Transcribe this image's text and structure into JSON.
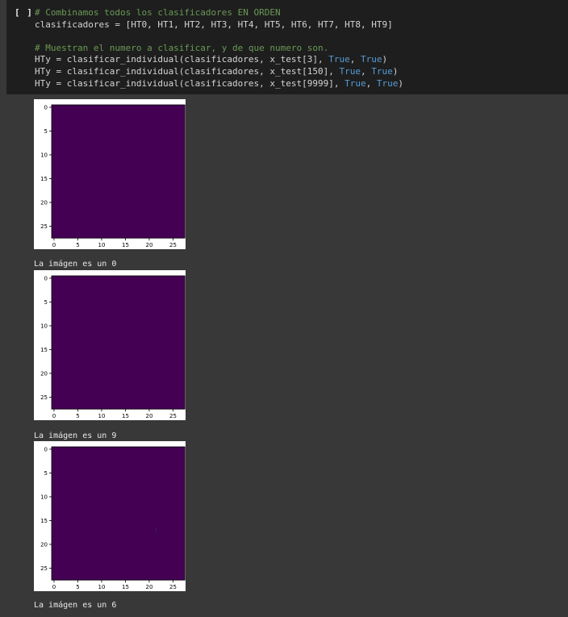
{
  "cell": {
    "run_label": "[ ]",
    "code_lines": [
      {
        "parts": [
          {
            "t": "# Combinamos todos los clasificadores EN ORDEN",
            "c": "cmt"
          }
        ]
      },
      {
        "parts": [
          {
            "t": "clasificadores = [HT0, HT1, HT2, HT3, HT4, HT5, HT6, HT7, HT8, HT9]",
            "c": ""
          }
        ]
      },
      {
        "parts": [
          {
            "t": "",
            "c": ""
          }
        ]
      },
      {
        "parts": [
          {
            "t": "# Muestran el numero a clasificar, y de que numero son.",
            "c": "cmt"
          }
        ]
      },
      {
        "parts": [
          {
            "t": "HTy = clasificar_individual(clasificadores, x_test[3], ",
            "c": ""
          },
          {
            "t": "True",
            "c": "kw"
          },
          {
            "t": ", ",
            "c": ""
          },
          {
            "t": "True",
            "c": "kw"
          },
          {
            "t": ")",
            "c": ""
          }
        ]
      },
      {
        "parts": [
          {
            "t": "HTy = clasificar_individual(clasificadores, x_test[150], ",
            "c": ""
          },
          {
            "t": "True",
            "c": "kw"
          },
          {
            "t": ", ",
            "c": ""
          },
          {
            "t": "True",
            "c": "kw"
          },
          {
            "t": ")",
            "c": ""
          }
        ]
      },
      {
        "parts": [
          {
            "t": "HTy = clasificar_individual(clasificadores, x_test[9999], ",
            "c": ""
          },
          {
            "t": "True",
            "c": "kw"
          },
          {
            "t": ", ",
            "c": ""
          },
          {
            "t": "True",
            "c": "kw"
          },
          {
            "t": ")",
            "c": ""
          }
        ]
      }
    ]
  },
  "outputs": [
    {
      "digit": "0",
      "text": "La imágen es un 0"
    },
    {
      "digit": "9",
      "text": "La imágen es un 9"
    },
    {
      "digit": "6",
      "text": "La imágen es un 6"
    }
  ],
  "axes": {
    "xticks": [
      "0",
      "5",
      "10",
      "15",
      "20",
      "25"
    ],
    "yticks": [
      "0",
      "5",
      "10",
      "15",
      "20",
      "25"
    ]
  },
  "colors": {
    "background": "#440154",
    "stroke": "#fde725",
    "edge": "#21918c"
  }
}
